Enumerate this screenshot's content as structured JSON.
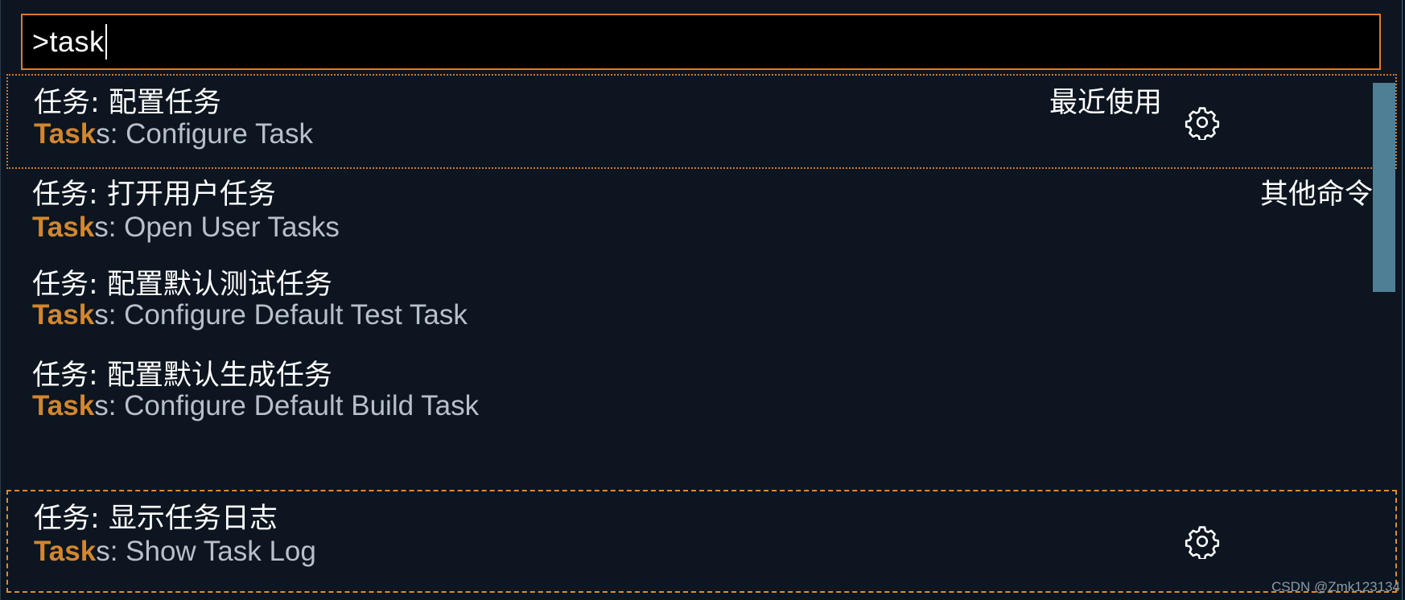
{
  "search": {
    "value": ">task"
  },
  "items": [
    {
      "label_cn": "任务: 配置任务",
      "label_en_highlight": "Task",
      "label_en_rest": "s: Configure Task",
      "badge": "最近使用"
    },
    {
      "label_cn": "任务: 打开用户任务",
      "label_en_highlight": "Task",
      "label_en_rest": "s: Open User Tasks",
      "badge": "其他命令"
    },
    {
      "label_cn": "任务: 配置默认测试任务",
      "label_en_highlight": "Task",
      "label_en_rest": "s: Configure Default Test Task"
    },
    {
      "label_cn": "任务: 配置默认生成任务",
      "label_en_highlight": "Task",
      "label_en_rest": "s: Configure Default Build Task"
    },
    {
      "label_cn": "任务: 显示任务日志",
      "label_en_highlight": "Task",
      "label_en_rest": "s: Show Task Log"
    }
  ],
  "icons": {
    "gear": "gear-icon"
  },
  "colors": {
    "background": "#0c1520",
    "input_border": "#e07b27",
    "highlight": "#d2862e",
    "secondary_text": "#b8c0c8",
    "scrollbar": "#4f7f95"
  },
  "watermark": "CSDN @Zmk123134"
}
